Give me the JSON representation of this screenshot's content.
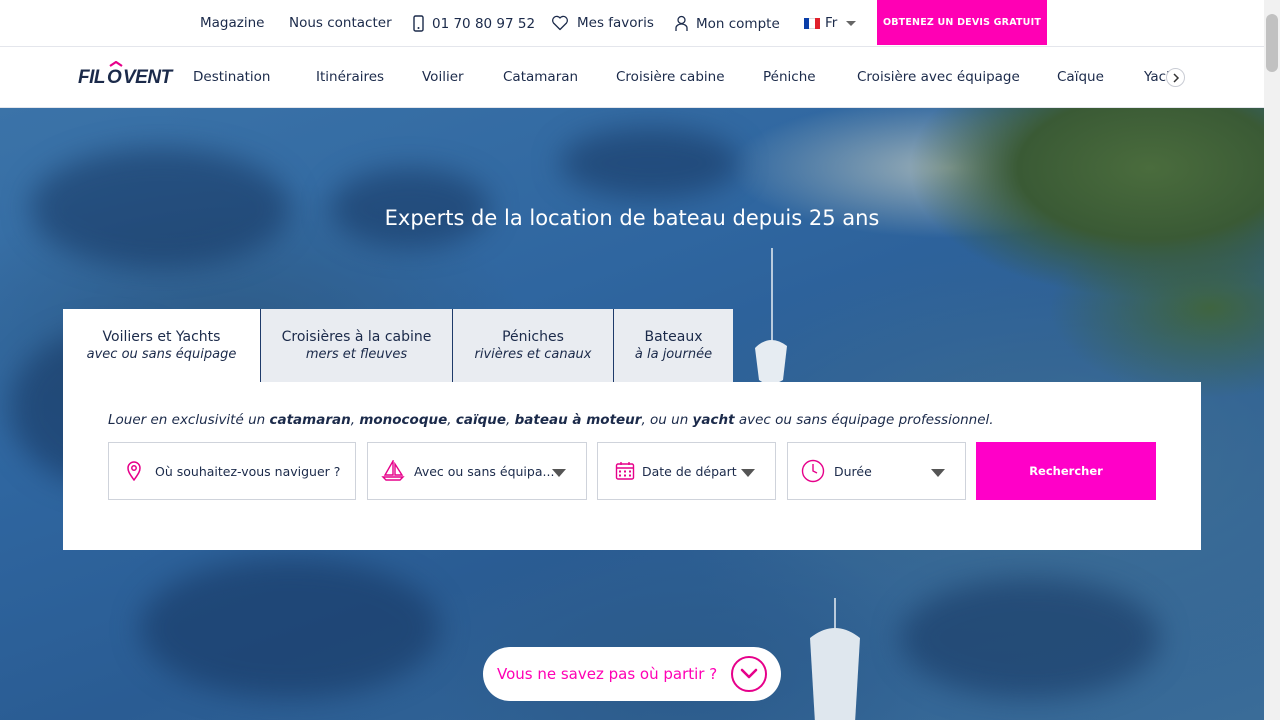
{
  "topbar": {
    "magazine": "Magazine",
    "contact": "Nous contacter",
    "phone": "01 70 80 97 52",
    "favorites": "Mes favoris",
    "account": "Mon compte",
    "language": "Fr",
    "cta": "OBTENEZ UN DEVIS GRATUIT"
  },
  "brand": {
    "logo_text": "FILOVENT",
    "accent": "#ff00b4",
    "navy": "#1b2a4a"
  },
  "nav": {
    "items": [
      "Destination",
      "Itinéraires",
      "Voilier",
      "Catamaran",
      "Croisière cabine",
      "Péniche",
      "Croisière avec équipage",
      "Caïque"
    ],
    "truncated_item": "Yacht"
  },
  "hero": {
    "title": "Experts de la location de bateau depuis 25 ans"
  },
  "tabs": [
    {
      "title": "Voiliers et Yachts",
      "subtitle": "avec ou sans équipage"
    },
    {
      "title": "Croisières à la cabine",
      "subtitle": "mers et fleuves"
    },
    {
      "title": "Péniches",
      "subtitle": "rivières et canaux"
    },
    {
      "title": "Bateaux",
      "subtitle": "à la journée"
    }
  ],
  "search": {
    "desc_parts": [
      "Louer en exclusivité un ",
      "catamaran",
      ", ",
      "monocoque",
      ", ",
      "caïque",
      ", ",
      "bateau à moteur",
      ", ou un ",
      "yacht",
      " avec ou sans équipage professionnel."
    ],
    "destination_placeholder": "Où souhaitez-vous naviguer ?",
    "crew_label": "Avec ou sans équipa...",
    "date_label": "Date de départ",
    "duration_label": "Durée",
    "button": "Rechercher"
  },
  "helper": {
    "label": "Vous ne savez pas où partir ?"
  },
  "icons": [
    "phone-icon",
    "heart-icon",
    "user-icon",
    "flag-fr-icon",
    "chevron-right-icon",
    "location-pin-icon",
    "sailboat-icon",
    "calendar-icon",
    "clock-icon",
    "chevron-down-icon"
  ]
}
